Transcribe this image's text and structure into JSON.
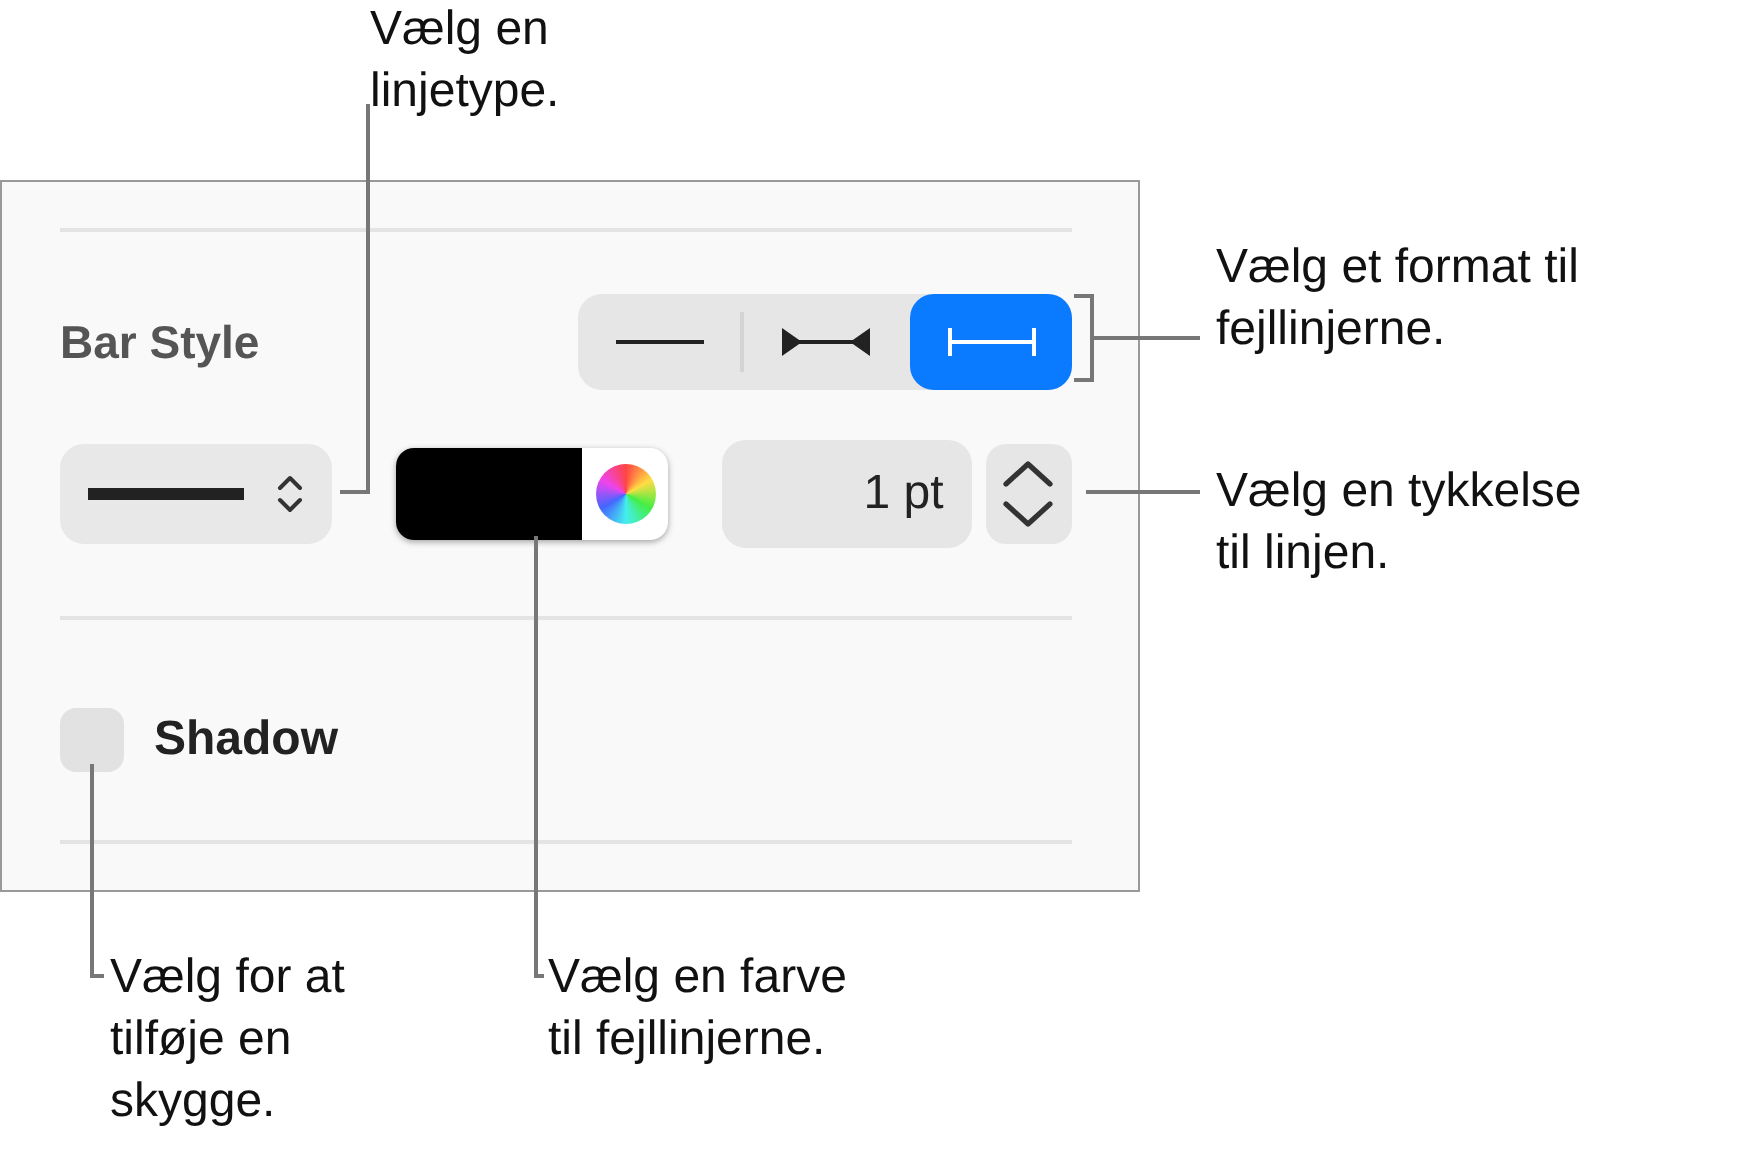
{
  "panel": {
    "section_title": "Bar Style",
    "bar_formats": [
      {
        "kind": "plain",
        "selected": false
      },
      {
        "kind": "arrows",
        "selected": false
      },
      {
        "kind": "caps",
        "selected": true
      }
    ],
    "line_style": {
      "kind": "solid"
    },
    "color_well": {
      "color": "#000000"
    },
    "thickness": {
      "value": "1 pt"
    },
    "shadow": {
      "label": "Shadow",
      "checked": false
    }
  },
  "callouts": [
    {
      "text": "Vælg en\nlinjetype."
    },
    {
      "text": "Vælg et format til\nfejllinjerne."
    },
    {
      "text": "Vælg en tykkelse\ntil linjen."
    },
    {
      "text": "Vælg for at\ntilføje en\nskygge."
    },
    {
      "text": "Vælg en farve\ntil fejllinjerne."
    }
  ]
}
